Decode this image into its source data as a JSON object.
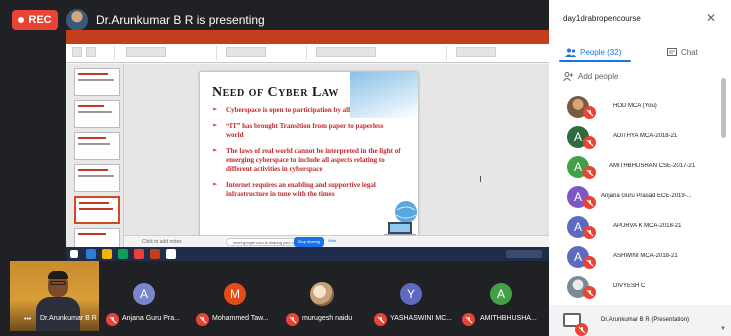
{
  "topbar": {
    "rec_label": "REC",
    "presenting_text": "Dr.Arunkumar B R is presenting"
  },
  "slide": {
    "title": "Need of Cyber Law",
    "bullets": [
      "Cyberspace is open to participation by all",
      "“IT” has brought Transition from paper to paperless world",
      "The laws of real world cannot be interpreted in the light of emerging cyberspace to include all aspects relating to different activities in cyberspace",
      "Internet requires an enabling and supportive legal infrastructure in tune with the times"
    ]
  },
  "strip": {
    "self_name": "Dr.Arunkumar B R",
    "tiles": [
      {
        "name": "Anjana Guru Pra...",
        "initial": "A",
        "color": "#7986cb"
      },
      {
        "name": "Mohammed Taw...",
        "initial": "M",
        "color": "#e64a19"
      },
      {
        "name": "murugesh naidu",
        "initial": "",
        "color": "#3c4043"
      },
      {
        "name": "YASHASWINI MC...",
        "initial": "Y",
        "color": "#5c6bc0"
      },
      {
        "name": "AMITHBHUSHA...",
        "initial": "A",
        "color": "#43a047"
      }
    ]
  },
  "panel": {
    "meeting_title": "day1drabropencourse",
    "close_icon": "close-icon",
    "tabs": {
      "people": "People (32)",
      "chat": "Chat"
    },
    "add_people": "Add people",
    "participants": [
      {
        "name": "HOD MCA (You)",
        "initial": "",
        "color": "#8d6e63"
      },
      {
        "name": "ADITHYA MCA-2018-21",
        "initial": "A",
        "color": "#2e6b3f"
      },
      {
        "name": "AMITHBHUSHAN CSE-2017-21",
        "initial": "A",
        "color": "#43a047"
      },
      {
        "name": "Anjana Guru Prasad ECE-2019-...",
        "initial": "A",
        "color": "#7e57c2"
      },
      {
        "name": "APURVA K MCA-2018-21",
        "initial": "A",
        "color": "#5c6bc0"
      },
      {
        "name": "ASHWINI MCA-2018-21",
        "initial": "A",
        "color": "#5c6bc0"
      },
      {
        "name": "DIVYESH C",
        "initial": "",
        "color": "#90a4ae"
      }
    ],
    "presentation_row": "Dr.Arunkumar B R (Presentation)"
  },
  "screen": {
    "notes_placeholder": "Click to add notes",
    "share_pill": "meet.google.com is sharing your screen.",
    "stop_label": "Stop sharing",
    "hide_label": "Hide"
  },
  "colors": {
    "meet_bg": "#202124",
    "accent_blue": "#1a73e8",
    "mute_red": "#ea4335",
    "slide_bullet_red": "#c0272d",
    "ppt_orange": "#c43e1c"
  }
}
